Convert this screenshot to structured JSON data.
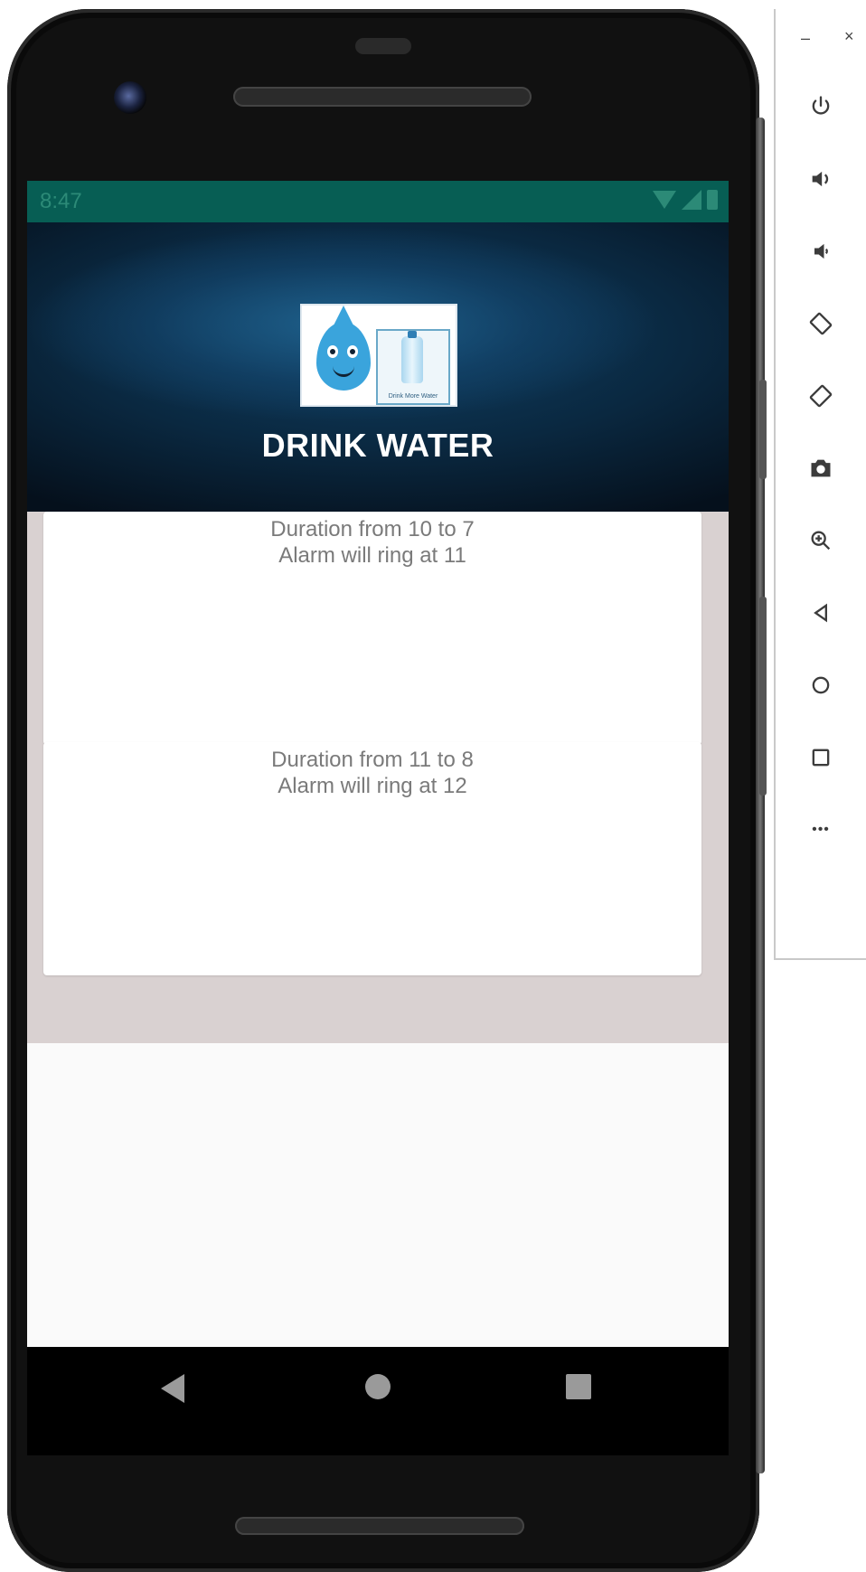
{
  "status_bar": {
    "time": "8:47"
  },
  "app": {
    "title": "DRINK WATER",
    "logo_caption": "Drink More Water"
  },
  "cards": [
    {
      "line1": "Duration from 10 to 7",
      "line2": "Alarm will ring at  11"
    },
    {
      "line1": "Duration from 11 to 8",
      "line2": "Alarm will ring at  12"
    }
  ],
  "emulator_panel": {
    "minimize": "–",
    "close": "×",
    "more": "•••"
  },
  "colors": {
    "status_bar": "#075e54",
    "list_background": "#d9d1d1",
    "card": "#ffffff",
    "text": "#7a7a7a"
  }
}
